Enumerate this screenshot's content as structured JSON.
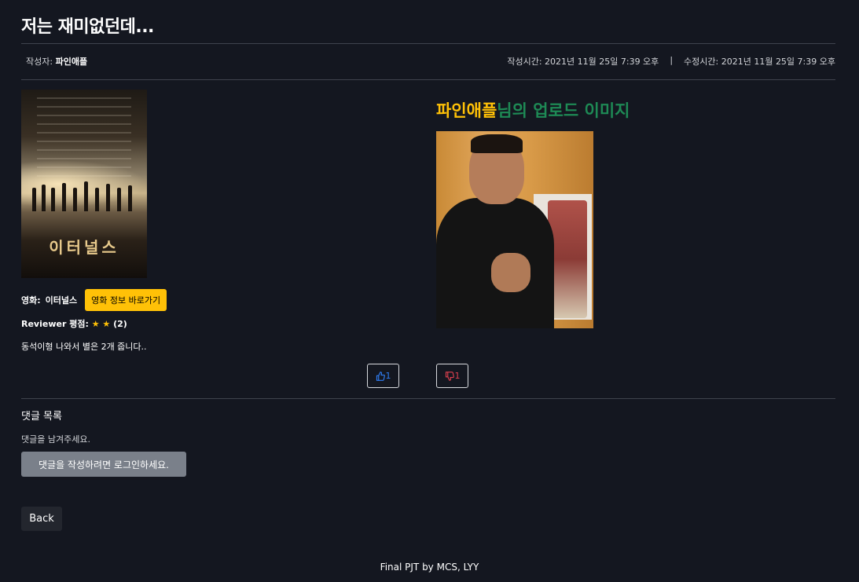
{
  "post": {
    "title": "저는 재미없던데...",
    "author_label": "작성자:",
    "author": "파인애플",
    "created": "작성시간: 2021년 11월 25일 7:39 오후",
    "separator": "|",
    "updated": "수정시간: 2021년 11월 25일 7:39 오후"
  },
  "movie": {
    "poster_title": "이터널스",
    "label": "영화:",
    "name": "이터널스",
    "info_button": "영화 정보 바로가기"
  },
  "review": {
    "rating_label": "Reviewer 평점:",
    "stars": "★ ★",
    "score": "(2)",
    "rating_value": 2,
    "text": "동석이형 나와서 별은 2개 줍니다.."
  },
  "upload": {
    "username": "파인애플",
    "suffix": "님의 업로드 이미지"
  },
  "votes": {
    "like_count": "1",
    "dislike_count": "1"
  },
  "comments": {
    "heading": "댓글 목록",
    "empty_text": "댓글을 남겨주세요.",
    "login_button": "댓글을 작성하려면 로그인하세요."
  },
  "nav": {
    "back_label": "Back"
  },
  "footer": {
    "text": "Final PJT by MCS, LYY"
  },
  "colors": {
    "background": "#141720",
    "accent_yellow": "#ffc107",
    "accent_green": "#1e8a55",
    "like_blue": "#2f7ef5",
    "dislike_red": "#e0404f"
  },
  "icons": {
    "like": "thumbs-up-icon",
    "dislike": "thumbs-down-icon"
  }
}
